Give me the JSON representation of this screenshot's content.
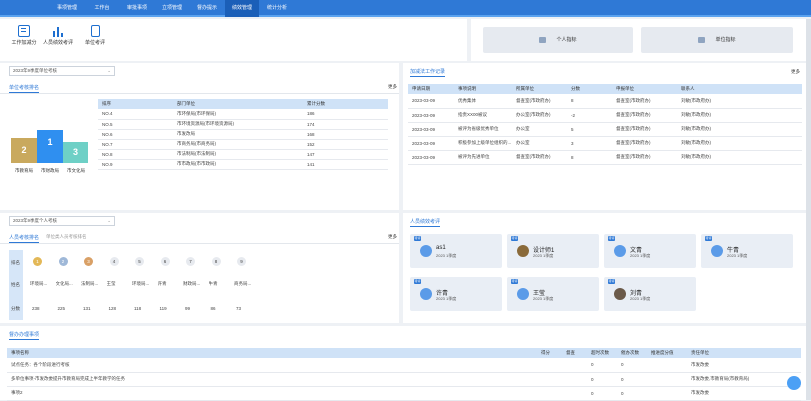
{
  "nav": {
    "tabs": [
      "事项管理",
      "工作台",
      "审批事项",
      "立项管理",
      "督办提示",
      "绩效管理",
      "统计分析"
    ],
    "active": 5
  },
  "quick_actions": [
    {
      "label": "工作加减分",
      "icon": "document-icon"
    },
    {
      "label": "人员绩效考评",
      "icon": "bar-chart-icon"
    },
    {
      "label": "单位考评",
      "icon": "book-icon"
    }
  ],
  "cards": [
    "个人指标",
    "单位指标"
  ],
  "unit_panel": {
    "select": "2023年9季度单位考核",
    "title": "单位考核排名",
    "more": "更多",
    "podium": [
      {
        "rank": "2",
        "label": "市教育局",
        "color": "#c9a95e"
      },
      {
        "rank": "1",
        "label": "市财政局",
        "color": "#2f8ff0"
      },
      {
        "rank": "3",
        "label": "市文化局",
        "color": "#6ed0c6"
      }
    ],
    "headers": [
      "排序",
      "部门单位",
      "累计分数"
    ],
    "rows": [
      [
        "NO.4",
        "市环保局(市环保局)",
        "186"
      ],
      [
        "NO.5",
        "市环境资源局(市环境资源局)",
        "174"
      ],
      [
        "NO.6",
        "市发改局",
        "168"
      ],
      [
        "NO.7",
        "市商务局(市商务局)",
        "152"
      ],
      [
        "NO.8",
        "市法制局(市法制局)",
        "147"
      ],
      [
        "NO.9",
        "市市政局(市市政局)",
        "141"
      ]
    ]
  },
  "log_panel": {
    "title": "加减法工作记录",
    "more": "更多",
    "headers": [
      "申请日期",
      "事项说明",
      "所属单位",
      "分数",
      "申报单位",
      "联系人"
    ],
    "rows": [
      [
        "2023-03-09",
        "优秀集体",
        "督查室(市政府办)",
        "8",
        "督查室(市政府办)",
        "刘敏(市政府办)"
      ],
      [
        "2023-03-09",
        "指责XX00被议",
        "办公室(市政府办)",
        "-2",
        "督查室(市政府办)",
        "刘敏(市政府办)"
      ],
      [
        "2023-03-09",
        "被评为省级优秀单位",
        "办公室",
        "5",
        "督查室(市政府办)",
        "刘敏(市政府办)"
      ],
      [
        "2023-03-09",
        "积极参加上级单位组织的...",
        "办公室",
        "3",
        "督查室(市政府办)",
        "刘敏(市政府办)"
      ],
      [
        "2023-03-09",
        "被评为先进单位",
        "督查室(市政府办)",
        "8",
        "督查室(市政府办)",
        "刘敏(市政府办)"
      ]
    ]
  },
  "person_panel": {
    "select": "2023年9季度个人考核",
    "tab_active": "人员考核排名",
    "tab_other": "单位类人员考核排名",
    "more": "更多",
    "row_labels": [
      "排名",
      "姓名",
      "分数"
    ],
    "ranks": [
      "1",
      "2",
      "3",
      "4",
      "5",
      "6",
      "7",
      "8",
      "9"
    ],
    "names": [
      "环境局...",
      "文化局...",
      "法制局...",
      "王莹",
      "环境局...",
      "许青",
      "财政局...",
      "牛青",
      "商务局..."
    ],
    "scores": [
      "238",
      "225",
      "131",
      "128",
      "118",
      "119",
      "99",
      "86",
      "73"
    ]
  },
  "eval_panel": {
    "title": "人员绩效考评",
    "people": [
      {
        "name": "as1",
        "year": "2023 1季度",
        "badge": "待评"
      },
      {
        "name": "设计师1",
        "year": "2023 1季度",
        "badge": "待评"
      },
      {
        "name": "文青",
        "year": "2023 1季度",
        "badge": "待评"
      },
      {
        "name": "牛青",
        "year": "2023 1季度",
        "badge": "待评"
      },
      {
        "name": "许青",
        "year": "2023 1季度",
        "badge": "待评"
      },
      {
        "name": "王莹",
        "year": "2023 1季度",
        "badge": "待评"
      },
      {
        "name": "刘青",
        "year": "2023 1季度",
        "badge": "待评"
      }
    ]
  },
  "task_panel": {
    "title": "督办办理事项",
    "headers": [
      "事项名称",
      "得分",
      "督查",
      "超时次数",
      "催办次数",
      "推进度分值",
      "责任单位"
    ],
    "rows": [
      [
        "试点任务：各个阶段进行考核",
        "",
        "",
        "0",
        "0",
        "",
        "市发改委"
      ],
      [
        "多单位事项-市发改委提升市教育局完成上半年教学的任务",
        "",
        "",
        "0",
        "0",
        "",
        "市发改委,市教育局(市教育局)"
      ],
      [
        "事项2",
        "",
        "",
        "0",
        "0",
        "",
        "市发改委"
      ]
    ]
  }
}
